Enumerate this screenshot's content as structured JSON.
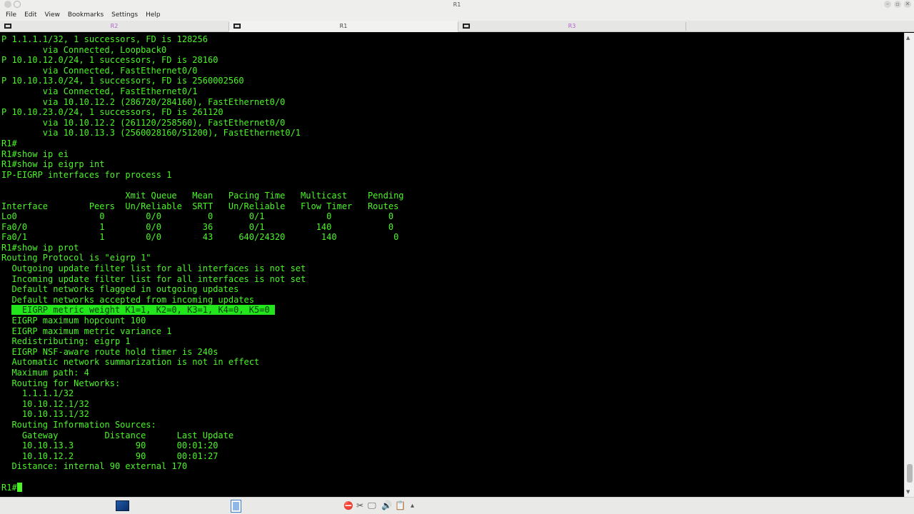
{
  "window": {
    "title": "R1",
    "close_glyph": "✕",
    "restore_glyph": "▫",
    "minimize_glyph": "–"
  },
  "menu": [
    "File",
    "Edit",
    "View",
    "Bookmarks",
    "Settings",
    "Help"
  ],
  "tabs": [
    {
      "label": "R2",
      "active": false,
      "color": "#b560d0"
    },
    {
      "label": "R1",
      "active": true,
      "color": "#444444"
    },
    {
      "label": "R3",
      "active": false,
      "color": "#b560d0"
    }
  ],
  "terminal": {
    "text_color": "#4af626",
    "highlight_color": "#22e51c",
    "lines": [
      "P 1.1.1.1/32, 1 successors, FD is 128256",
      "        via Connected, Loopback0",
      "P 10.10.12.0/24, 1 successors, FD is 28160",
      "        via Connected, FastEthernet0/0",
      "P 10.10.13.0/24, 1 successors, FD is 2560002560",
      "        via Connected, FastEthernet0/1",
      "        via 10.10.12.2 (286720/284160), FastEthernet0/0",
      "P 10.10.23.0/24, 1 successors, FD is 261120",
      "        via 10.10.12.2 (261120/258560), FastEthernet0/0",
      "        via 10.10.13.3 (2560028160/51200), FastEthernet0/1",
      "R1#",
      "R1#show ip ei",
      "R1#show ip eigrp int",
      "IP-EIGRP interfaces for process 1",
      "",
      "                        Xmit Queue   Mean   Pacing Time   Multicast    Pending",
      "Interface        Peers  Un/Reliable  SRTT   Un/Reliable   Flow Timer   Routes",
      "Lo0                0        0/0         0       0/1            0           0",
      "Fa0/0              1        0/0        36       0/1          140           0",
      "Fa0/1              1        0/0        43     640/24320       140           0",
      "R1#show ip prot",
      "Routing Protocol is \"eigrp 1\"",
      "  Outgoing update filter list for all interfaces is not set",
      "  Incoming update filter list for all interfaces is not set",
      "  Default networks flagged in outgoing updates",
      "  Default networks accepted from incoming updates",
      "  EIGRP metric weight K1=1, K2=0, K3=1, K4=0, K5=0 ",
      "  EIGRP maximum hopcount 100",
      "  EIGRP maximum metric variance 1",
      "  Redistributing: eigrp 1",
      "  EIGRP NSF-aware route hold timer is 240s",
      "  Automatic network summarization is not in effect",
      "  Maximum path: 4",
      "  Routing for Networks:",
      "    1.1.1.1/32",
      "    10.10.12.1/32",
      "    10.10.13.1/32",
      "  Routing Information Sources:",
      "    Gateway         Distance      Last Update",
      "    10.10.13.3            90      00:01:20",
      "    10.10.12.2            90      00:01:27",
      "  Distance: internal 90 external 170",
      "",
      "R1#"
    ],
    "highlighted_line_index": 26,
    "prompt_line_index": 43
  },
  "taskbar": {
    "terminal_icon": "terminal-icon",
    "files_icon": "file-manager-icon",
    "tray": [
      {
        "name": "stop-icon",
        "glyph": "⛔"
      },
      {
        "name": "tools-icon",
        "glyph": "✂"
      },
      {
        "name": "display-icon",
        "glyph": "🖵"
      },
      {
        "name": "volume-icon",
        "glyph": "🔊"
      },
      {
        "name": "clipboard-icon",
        "glyph": "📋"
      },
      {
        "name": "expand-tray-icon",
        "glyph": "▴"
      }
    ]
  }
}
